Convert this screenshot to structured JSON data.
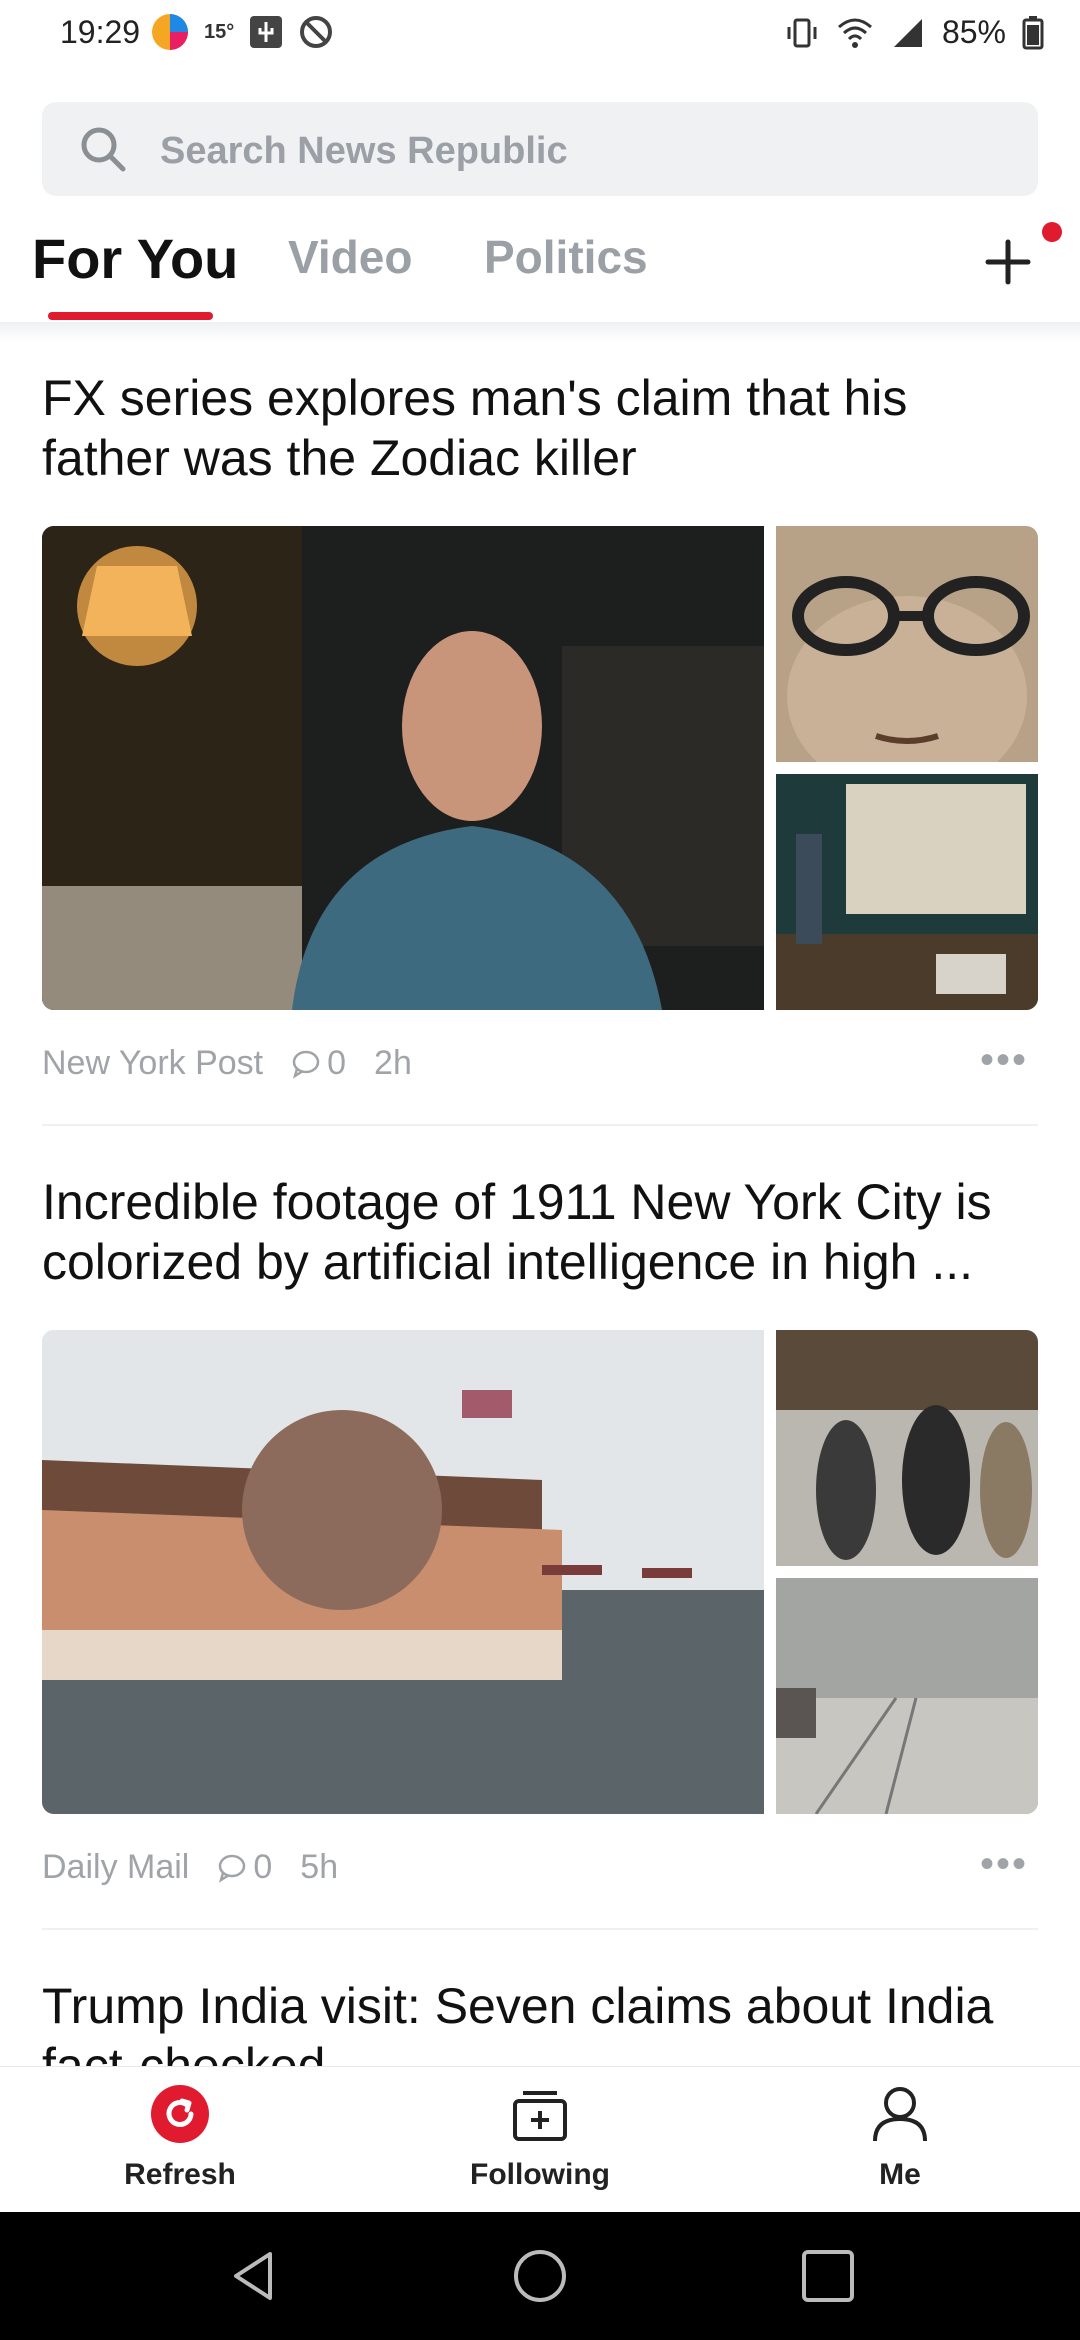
{
  "status": {
    "time": "19:29",
    "temp": "15°",
    "battery": "85%"
  },
  "search": {
    "placeholder": "Search News Republic"
  },
  "tabs": [
    {
      "label": "For You",
      "active": true
    },
    {
      "label": "Video",
      "active": false
    },
    {
      "label": "Politics",
      "active": false
    }
  ],
  "articles": [
    {
      "title": "FX series explores man's claim that his father was the Zodiac killer",
      "source": "New York Post",
      "comments": "0",
      "age": "2h"
    },
    {
      "title": "Incredible footage of 1911 New York City is colorized by artificial intelligence in high ...",
      "source": "Daily Mail",
      "comments": "0",
      "age": "5h"
    },
    {
      "title": "Trump India visit: Seven claims about India fact-checked"
    }
  ],
  "nav": {
    "refresh": "Refresh",
    "following": "Following",
    "me": "Me"
  },
  "colors": {
    "accent": "#e01b2f"
  }
}
